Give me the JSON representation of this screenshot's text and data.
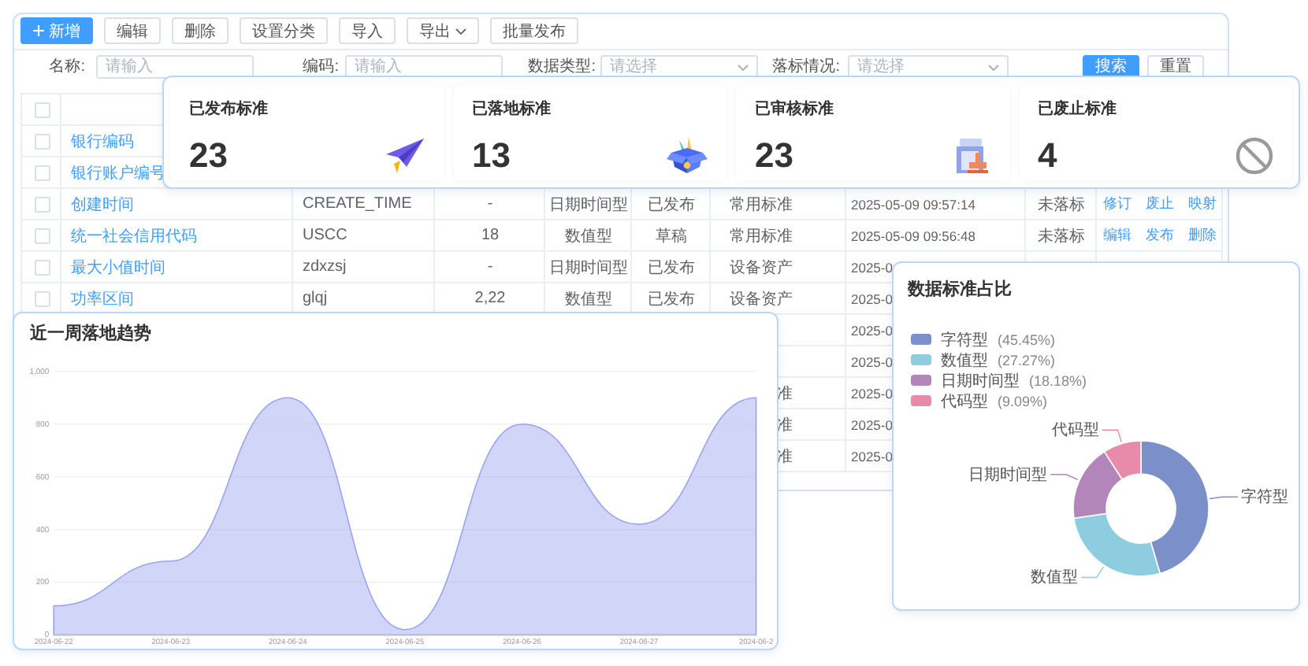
{
  "toolbar": [
    {
      "label": "新增",
      "kind": "primary"
    },
    {
      "label": "编辑",
      "kind": "plain"
    },
    {
      "label": "删除",
      "kind": "plain"
    },
    {
      "label": "设置分类",
      "kind": "plain"
    },
    {
      "label": "导入",
      "kind": "plain"
    },
    {
      "label": "导出",
      "kind": "dropdown"
    },
    {
      "label": "批量发布",
      "kind": "plain"
    }
  ],
  "filters": [
    {
      "label": "名称:",
      "kind": "input",
      "placeholder": "请输入"
    },
    {
      "label": "编码:",
      "kind": "input",
      "placeholder": "请输入"
    },
    {
      "label": "数据类型:",
      "kind": "select",
      "placeholder": "请选择"
    },
    {
      "label": "落标情况:",
      "kind": "select",
      "placeholder": "请选择"
    }
  ],
  "filter_buttons": [
    {
      "label": "搜索",
      "kind": "primary"
    },
    {
      "label": "重置",
      "kind": "plain"
    }
  ],
  "table": {
    "header_checked": false,
    "rows": [
      {
        "checked": false,
        "name": "银行编码"
      },
      {
        "checked": false,
        "name": "银行账户编号"
      },
      {
        "checked": false,
        "name": "创建时间",
        "code": "CREATE_TIME",
        "length": "-",
        "type": "日期时间型",
        "status": "已发布",
        "category": "常用标准",
        "time": "2025-05-09 09:57:14",
        "landing": "未落标",
        "actions": [
          "修订",
          "废止",
          "映射"
        ]
      },
      {
        "checked": false,
        "name": "统一社会信用代码",
        "code": "USCC",
        "length": "18",
        "type": "数值型",
        "status": "草稿",
        "category": "常用标准",
        "time": "2025-05-09 09:56:48",
        "landing": "未落标",
        "actions": [
          "编辑",
          "发布",
          "删除"
        ]
      },
      {
        "checked": false,
        "name": "最大小值时间",
        "code": "zdxzsj",
        "length": "-",
        "type": "日期时间型",
        "status": "已发布",
        "category": "设备资产",
        "time": "2025-0"
      },
      {
        "checked": false,
        "name": "功率区间",
        "code": "glqj",
        "length": "2,22",
        "type": "数值型",
        "status": "已发布",
        "category": "设备资产",
        "time": "2025-0"
      },
      {
        "time": "2025-0"
      },
      {
        "time": "2025-0"
      },
      {
        "category": "准",
        "time": "2025-0"
      },
      {
        "category": "准",
        "time": "2025-0"
      },
      {
        "category": "准",
        "time": "2025-0"
      }
    ]
  },
  "stats": [
    {
      "label": "已发布标准",
      "value": "23",
      "kind": "plane"
    },
    {
      "label": "已落地标准",
      "value": "13",
      "kind": "box"
    },
    {
      "label": "已审核标准",
      "value": "23",
      "kind": "stamp"
    },
    {
      "label": "已废止标准",
      "value": "4",
      "kind": "ban"
    }
  ],
  "trend": {
    "title": "近一周落地趋势",
    "chart_data": {
      "type": "area",
      "categories": [
        "2024-06-22",
        "2024-06-23",
        "2024-06-24",
        "2024-06-25",
        "2024-06-26",
        "2024-06-27",
        "2024-06-2"
      ],
      "series": [
        {
          "color": "#9aa3f0",
          "values": [
            110,
            280,
            900,
            20,
            800,
            420,
            900
          ]
        }
      ],
      "ylim": [
        0,
        1000
      ],
      "grid": true,
      "yticks": [
        0,
        200,
        400,
        600,
        800,
        {
          "value": 1000,
          "label": "1,000"
        }
      ]
    }
  },
  "share": {
    "title": "数据标准占比",
    "chart_data": {
      "type": "donut",
      "categories": [
        "字符型",
        "数值型",
        "日期时间型",
        "代码型"
      ],
      "series": [
        {
          "values": [
            45.45,
            27.27,
            18.18,
            9.09
          ]
        }
      ]
    },
    "legend": [
      {
        "label": "字符型",
        "percent": "(45.45%)",
        "color": "#7b8fc8"
      },
      {
        "label": "数值型",
        "percent": "(27.27%)",
        "color": "#8ecce0"
      },
      {
        "label": "日期时间型",
        "percent": "(18.18%)",
        "color": "#b386b9"
      },
      {
        "label": "代码型",
        "percent": "(9.09%)",
        "color": "#e88aaa"
      }
    ]
  }
}
